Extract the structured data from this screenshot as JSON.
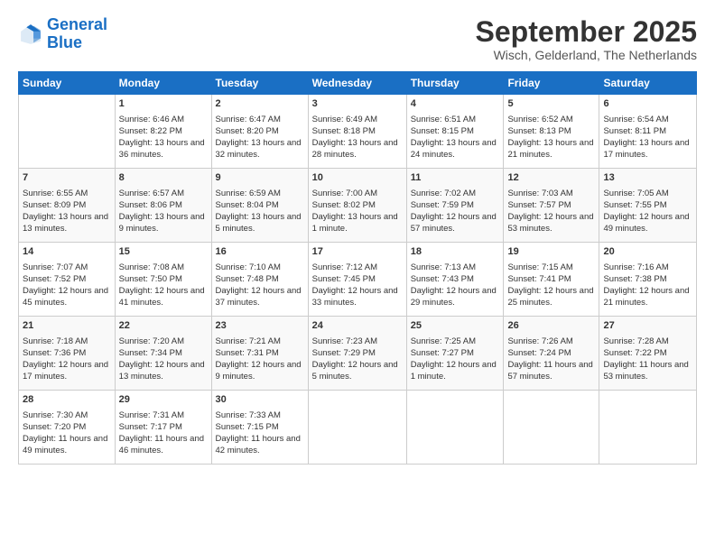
{
  "header": {
    "logo_line1": "General",
    "logo_line2": "Blue",
    "month": "September 2025",
    "location": "Wisch, Gelderland, The Netherlands"
  },
  "days_of_week": [
    "Sunday",
    "Monday",
    "Tuesday",
    "Wednesday",
    "Thursday",
    "Friday",
    "Saturday"
  ],
  "weeks": [
    [
      {
        "day": "",
        "sunrise": "",
        "sunset": "",
        "daylight": ""
      },
      {
        "day": "1",
        "sunrise": "Sunrise: 6:46 AM",
        "sunset": "Sunset: 8:22 PM",
        "daylight": "Daylight: 13 hours and 36 minutes."
      },
      {
        "day": "2",
        "sunrise": "Sunrise: 6:47 AM",
        "sunset": "Sunset: 8:20 PM",
        "daylight": "Daylight: 13 hours and 32 minutes."
      },
      {
        "day": "3",
        "sunrise": "Sunrise: 6:49 AM",
        "sunset": "Sunset: 8:18 PM",
        "daylight": "Daylight: 13 hours and 28 minutes."
      },
      {
        "day": "4",
        "sunrise": "Sunrise: 6:51 AM",
        "sunset": "Sunset: 8:15 PM",
        "daylight": "Daylight: 13 hours and 24 minutes."
      },
      {
        "day": "5",
        "sunrise": "Sunrise: 6:52 AM",
        "sunset": "Sunset: 8:13 PM",
        "daylight": "Daylight: 13 hours and 21 minutes."
      },
      {
        "day": "6",
        "sunrise": "Sunrise: 6:54 AM",
        "sunset": "Sunset: 8:11 PM",
        "daylight": "Daylight: 13 hours and 17 minutes."
      }
    ],
    [
      {
        "day": "7",
        "sunrise": "Sunrise: 6:55 AM",
        "sunset": "Sunset: 8:09 PM",
        "daylight": "Daylight: 13 hours and 13 minutes."
      },
      {
        "day": "8",
        "sunrise": "Sunrise: 6:57 AM",
        "sunset": "Sunset: 8:06 PM",
        "daylight": "Daylight: 13 hours and 9 minutes."
      },
      {
        "day": "9",
        "sunrise": "Sunrise: 6:59 AM",
        "sunset": "Sunset: 8:04 PM",
        "daylight": "Daylight: 13 hours and 5 minutes."
      },
      {
        "day": "10",
        "sunrise": "Sunrise: 7:00 AM",
        "sunset": "Sunset: 8:02 PM",
        "daylight": "Daylight: 13 hours and 1 minute."
      },
      {
        "day": "11",
        "sunrise": "Sunrise: 7:02 AM",
        "sunset": "Sunset: 7:59 PM",
        "daylight": "Daylight: 12 hours and 57 minutes."
      },
      {
        "day": "12",
        "sunrise": "Sunrise: 7:03 AM",
        "sunset": "Sunset: 7:57 PM",
        "daylight": "Daylight: 12 hours and 53 minutes."
      },
      {
        "day": "13",
        "sunrise": "Sunrise: 7:05 AM",
        "sunset": "Sunset: 7:55 PM",
        "daylight": "Daylight: 12 hours and 49 minutes."
      }
    ],
    [
      {
        "day": "14",
        "sunrise": "Sunrise: 7:07 AM",
        "sunset": "Sunset: 7:52 PM",
        "daylight": "Daylight: 12 hours and 45 minutes."
      },
      {
        "day": "15",
        "sunrise": "Sunrise: 7:08 AM",
        "sunset": "Sunset: 7:50 PM",
        "daylight": "Daylight: 12 hours and 41 minutes."
      },
      {
        "day": "16",
        "sunrise": "Sunrise: 7:10 AM",
        "sunset": "Sunset: 7:48 PM",
        "daylight": "Daylight: 12 hours and 37 minutes."
      },
      {
        "day": "17",
        "sunrise": "Sunrise: 7:12 AM",
        "sunset": "Sunset: 7:45 PM",
        "daylight": "Daylight: 12 hours and 33 minutes."
      },
      {
        "day": "18",
        "sunrise": "Sunrise: 7:13 AM",
        "sunset": "Sunset: 7:43 PM",
        "daylight": "Daylight: 12 hours and 29 minutes."
      },
      {
        "day": "19",
        "sunrise": "Sunrise: 7:15 AM",
        "sunset": "Sunset: 7:41 PM",
        "daylight": "Daylight: 12 hours and 25 minutes."
      },
      {
        "day": "20",
        "sunrise": "Sunrise: 7:16 AM",
        "sunset": "Sunset: 7:38 PM",
        "daylight": "Daylight: 12 hours and 21 minutes."
      }
    ],
    [
      {
        "day": "21",
        "sunrise": "Sunrise: 7:18 AM",
        "sunset": "Sunset: 7:36 PM",
        "daylight": "Daylight: 12 hours and 17 minutes."
      },
      {
        "day": "22",
        "sunrise": "Sunrise: 7:20 AM",
        "sunset": "Sunset: 7:34 PM",
        "daylight": "Daylight: 12 hours and 13 minutes."
      },
      {
        "day": "23",
        "sunrise": "Sunrise: 7:21 AM",
        "sunset": "Sunset: 7:31 PM",
        "daylight": "Daylight: 12 hours and 9 minutes."
      },
      {
        "day": "24",
        "sunrise": "Sunrise: 7:23 AM",
        "sunset": "Sunset: 7:29 PM",
        "daylight": "Daylight: 12 hours and 5 minutes."
      },
      {
        "day": "25",
        "sunrise": "Sunrise: 7:25 AM",
        "sunset": "Sunset: 7:27 PM",
        "daylight": "Daylight: 12 hours and 1 minute."
      },
      {
        "day": "26",
        "sunrise": "Sunrise: 7:26 AM",
        "sunset": "Sunset: 7:24 PM",
        "daylight": "Daylight: 11 hours and 57 minutes."
      },
      {
        "day": "27",
        "sunrise": "Sunrise: 7:28 AM",
        "sunset": "Sunset: 7:22 PM",
        "daylight": "Daylight: 11 hours and 53 minutes."
      }
    ],
    [
      {
        "day": "28",
        "sunrise": "Sunrise: 7:30 AM",
        "sunset": "Sunset: 7:20 PM",
        "daylight": "Daylight: 11 hours and 49 minutes."
      },
      {
        "day": "29",
        "sunrise": "Sunrise: 7:31 AM",
        "sunset": "Sunset: 7:17 PM",
        "daylight": "Daylight: 11 hours and 46 minutes."
      },
      {
        "day": "30",
        "sunrise": "Sunrise: 7:33 AM",
        "sunset": "Sunset: 7:15 PM",
        "daylight": "Daylight: 11 hours and 42 minutes."
      },
      {
        "day": "",
        "sunrise": "",
        "sunset": "",
        "daylight": ""
      },
      {
        "day": "",
        "sunrise": "",
        "sunset": "",
        "daylight": ""
      },
      {
        "day": "",
        "sunrise": "",
        "sunset": "",
        "daylight": ""
      },
      {
        "day": "",
        "sunrise": "",
        "sunset": "",
        "daylight": ""
      }
    ]
  ]
}
